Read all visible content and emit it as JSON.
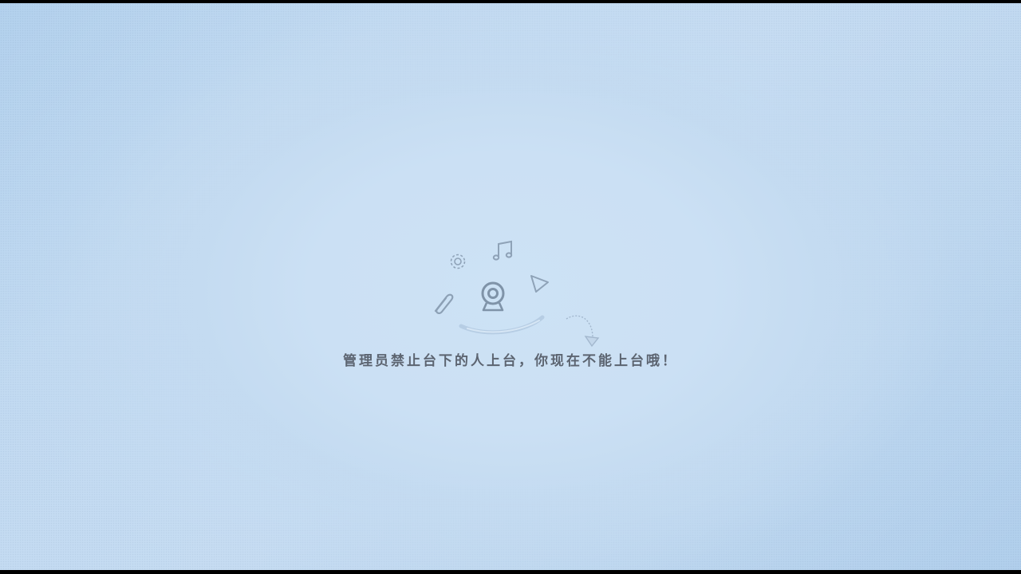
{
  "empty_state": {
    "message": "管理员禁止台下的人上台，你现在不能上台哦！"
  },
  "icons": [
    "gear-icon",
    "music-note-icon",
    "paperclip-icon",
    "webcam-icon",
    "play-icon",
    "arrow-icon"
  ],
  "colors": {
    "background": "#c6dcf2",
    "center_glow": "#cde2f5",
    "icon_stroke": "#7f93a8",
    "text": "#5c6470"
  }
}
